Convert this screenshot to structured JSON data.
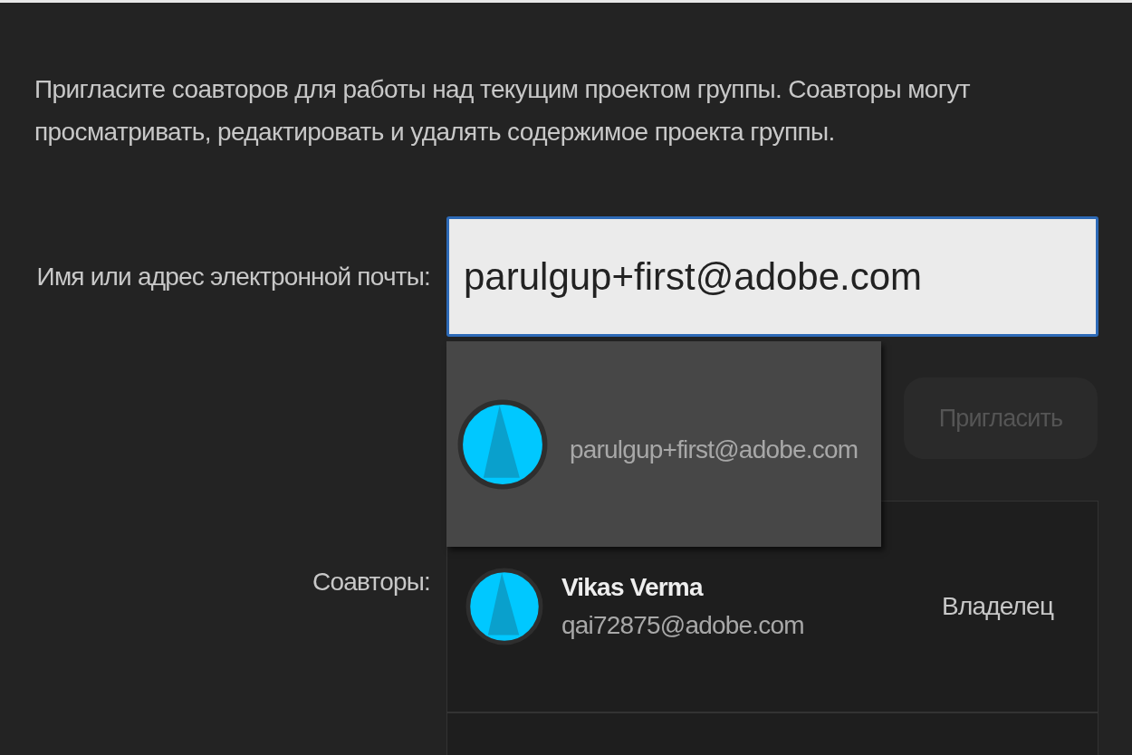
{
  "description": "Пригласите соавторов для работы над текущим проектом группы. Соавторы могут просматривать, редактировать и удалять содержимое проекта группы.",
  "email_field": {
    "label": "Имя или адрес электронной почты:",
    "value": "parulgup+first@adobe.com"
  },
  "suggestions": [
    {
      "email": "parulgup+first@adobe.com"
    }
  ],
  "invite_button": {
    "label": "Пригласить",
    "disabled": true
  },
  "collaborators": {
    "label": "Соавторы:",
    "items": [
      {
        "name": "Vikas Verma",
        "email": "qai72875@adobe.com",
        "role": "Владелец"
      }
    ]
  }
}
